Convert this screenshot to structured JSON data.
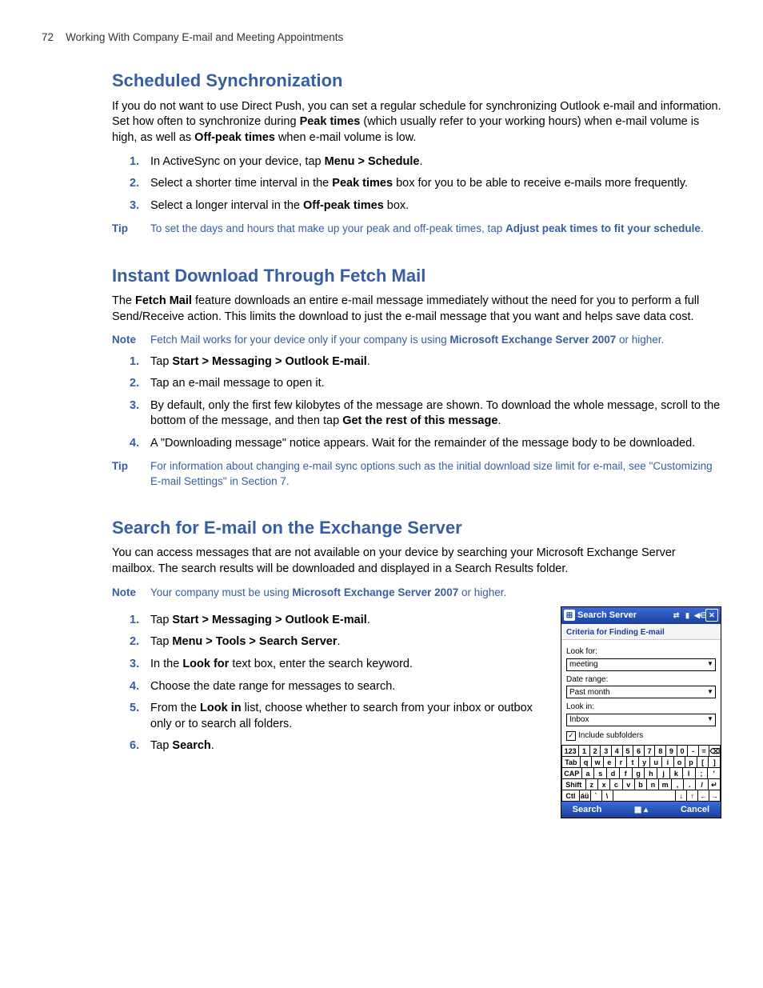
{
  "header": {
    "page_number": "72",
    "chapter_title": "Working With Company E-mail and Meeting Appointments"
  },
  "section1": {
    "title": "Scheduled Synchronization",
    "para_parts": [
      "If you do not want to use Direct Push, you can set a regular schedule for synchronizing Outlook e-mail and information. Set how often to synchronize during ",
      "Peak times",
      " (which usually refer to your working hours) when e-mail volume is high, as well as ",
      "Off-peak times",
      " when e-mail volume is low."
    ],
    "steps": [
      {
        "pre": "In ActiveSync on your device, tap ",
        "b1": "Menu > Schedule",
        "post": "."
      },
      {
        "pre": "Select a shorter time interval in the ",
        "b1": "Peak times",
        "post": " box for you to be able to receive e-mails more frequently."
      },
      {
        "pre": "Select a longer interval in the ",
        "b1": "Off-peak times",
        "post": " box."
      }
    ],
    "tip_label": "Tip",
    "tip_parts": [
      "To set the days and hours that make up your peak and off-peak times, tap ",
      "Adjust peak times to fit your schedule",
      "."
    ]
  },
  "section2": {
    "title": "Instant Download Through Fetch Mail",
    "para_parts": [
      "The ",
      "Fetch Mail",
      " feature downloads an entire e-mail message immediately without the need for you to perform a full Send/Receive action. This limits the download to just the e-mail message that you want and helps save data cost."
    ],
    "note_label": "Note",
    "note_parts": [
      "Fetch Mail works for your device only if your company is using ",
      "Microsoft Exchange Server 2007",
      " or higher."
    ],
    "steps": [
      {
        "pre": "Tap ",
        "b1": "Start > Messaging > Outlook E-mail",
        "post": "."
      },
      {
        "pre": "Tap an e-mail message to open it.",
        "b1": "",
        "post": ""
      },
      {
        "pre": "By default, only the first few kilobytes of the message are shown. To download the whole message, scroll to the bottom of the message, and then tap ",
        "b1": "Get the rest of this message",
        "post": "."
      },
      {
        "pre": "A \"Downloading message\" notice appears. Wait for the remainder of the message body to be downloaded.",
        "b1": "",
        "post": ""
      }
    ],
    "tip_label": "Tip",
    "tip_text": "For information about changing e-mail sync options such as the initial download size limit for e-mail, see \"Customizing E-mail Settings\" in Section 7."
  },
  "section3": {
    "title": "Search for E-mail on the Exchange Server",
    "para": "You can access messages that are not available on your device by searching your Microsoft Exchange Server mailbox. The search results will be downloaded and displayed in a Search Results folder.",
    "note_label": "Note",
    "note_parts": [
      "Your company must be using ",
      "Microsoft Exchange Server 2007",
      " or higher."
    ],
    "steps": [
      {
        "pre": "Tap ",
        "b1": "Start > Messaging > Outlook E-mail",
        "post": "."
      },
      {
        "pre": "Tap ",
        "b1": "Menu > Tools > Search Server",
        "post": "."
      },
      {
        "pre": "In the ",
        "b1": "Look for",
        "post": " text box, enter the search keyword."
      },
      {
        "pre": "Choose the date range for messages to search.",
        "b1": "",
        "post": ""
      },
      {
        "pre": "From the ",
        "b1": "Look in",
        "post": " list, choose whether to search from your inbox or outbox only or to search all folders."
      },
      {
        "pre": "Tap ",
        "b1": "Search",
        "post": "."
      }
    ]
  },
  "device": {
    "title": "Search Server",
    "criteria": "Criteria for Finding E-mail",
    "look_for_label": "Look for:",
    "look_for_value": "meeting",
    "date_range_label": "Date range:",
    "date_range_value": "Past month",
    "look_in_label": "Look in:",
    "look_in_value": "Inbox",
    "include_label": "Include subfolders",
    "soft_left": "Search",
    "soft_right": "Cancel",
    "keyboard": {
      "row1": [
        "123",
        "1",
        "2",
        "3",
        "4",
        "5",
        "6",
        "7",
        "8",
        "9",
        "0",
        "-",
        "=",
        "⌫"
      ],
      "row2": [
        "Tab",
        "q",
        "w",
        "e",
        "r",
        "t",
        "y",
        "u",
        "i",
        "o",
        "p",
        "[",
        "]"
      ],
      "row3": [
        "CAP",
        "a",
        "s",
        "d",
        "f",
        "g",
        "h",
        "j",
        "k",
        "l",
        ";",
        "'"
      ],
      "row4": [
        "Shift",
        "z",
        "x",
        "c",
        "v",
        "b",
        "n",
        "m",
        ",",
        ".",
        "/",
        "↵"
      ],
      "row5": [
        "Ctl",
        "áü",
        "`",
        "\\",
        " ",
        "↓",
        "↑",
        "←",
        "→"
      ]
    }
  }
}
